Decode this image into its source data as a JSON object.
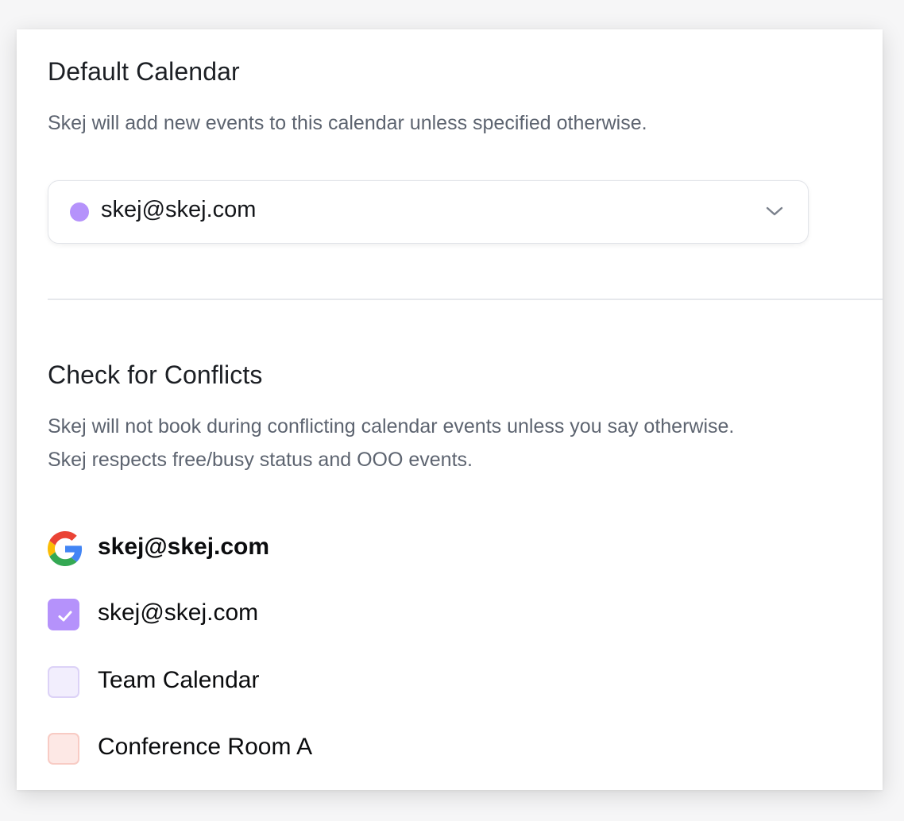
{
  "default_calendar": {
    "title": "Default Calendar",
    "description": "Skej will add new events to this calendar unless specified otherwise.",
    "selected": {
      "label": "skej@skej.com",
      "color": "#b592fb",
      "icon": "chevron-down-icon"
    }
  },
  "conflicts": {
    "title": "Check for Conflicts",
    "description_lines": [
      "Skej will not book during conflicting calendar events unless you say otherwise.",
      "Skej respects free/busy status and OOO events."
    ],
    "account": {
      "provider_icon": "google-icon",
      "email": "skej@skej.com"
    },
    "calendars": [
      {
        "label": "skej@skej.com",
        "checked": true,
        "color": "#b592fb",
        "border": "#b592fb"
      },
      {
        "label": "Team Calendar",
        "checked": false,
        "color": "#f2eefd",
        "border": "#dcd2f7"
      },
      {
        "label": "Conference Room A",
        "checked": false,
        "color": "#fde8e5",
        "border": "#f8cbc4"
      }
    ]
  }
}
